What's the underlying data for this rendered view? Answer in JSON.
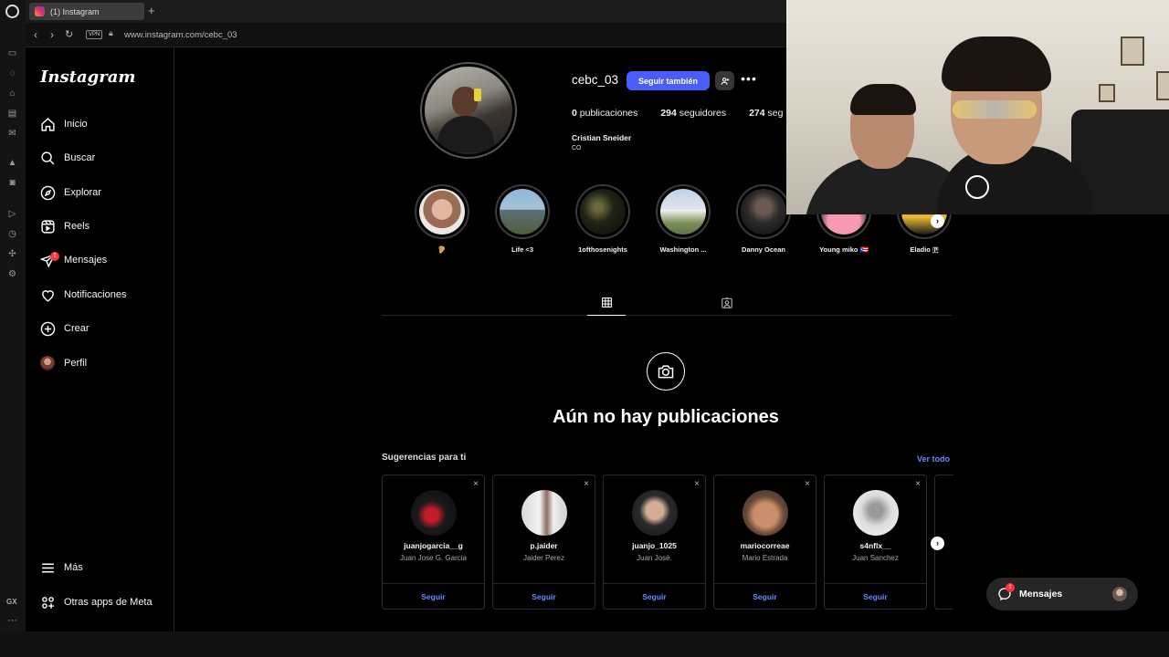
{
  "browser": {
    "tab_title": "(1) Instagram",
    "new_tab": "+",
    "url": "www.instagram.com/cebc_03",
    "vpn_label": "VPN",
    "gx_label": "GX",
    "more_dots": "···"
  },
  "sidebar": {
    "logo": "Instagram",
    "items": [
      {
        "label": "Inicio",
        "icon": "home-icon"
      },
      {
        "label": "Buscar",
        "icon": "search-icon"
      },
      {
        "label": "Explorar",
        "icon": "compass-icon"
      },
      {
        "label": "Reels",
        "icon": "reels-icon"
      },
      {
        "label": "Mensajes",
        "icon": "messenger-icon",
        "badge": "1"
      },
      {
        "label": "Notificaciones",
        "icon": "heart-icon"
      },
      {
        "label": "Crear",
        "icon": "plus-square-icon"
      },
      {
        "label": "Perfil",
        "icon": "avatar"
      }
    ],
    "bottom": [
      {
        "label": "Más",
        "icon": "menu-icon"
      },
      {
        "label": "Otras apps de Meta",
        "icon": "meta-apps-icon"
      }
    ]
  },
  "profile": {
    "username": "cebc_03",
    "follow_label": "Seguir también",
    "posts_count": "0",
    "posts_label": "publicaciones",
    "followers_count": "294",
    "followers_label": "seguidores",
    "following_count": "274",
    "following_label": "seg",
    "full_name": "Cristian Sneider",
    "bio": "CO"
  },
  "highlights": [
    {
      "caption": "🦻"
    },
    {
      "caption": "Life <3"
    },
    {
      "caption": "1ofthosenights"
    },
    {
      "caption": "Washington ..."
    },
    {
      "caption": "Danny Ocean"
    },
    {
      "caption": "Young miko 🇵🇷"
    },
    {
      "caption": "Eladio 🇵"
    }
  ],
  "empty_state": {
    "title": "Aún no hay publicaciones"
  },
  "suggestions": {
    "heading": "Sugerencias para ti",
    "see_all": "Ver todo",
    "follow_label": "Seguir",
    "close": "×",
    "cards": [
      {
        "username": "juanjogarcia__g",
        "name": "Juan Jose G. Garcia"
      },
      {
        "username": "p.jaider",
        "name": "Jaider Perez"
      },
      {
        "username": "juanjo_1025",
        "name": "Juan José."
      },
      {
        "username": "mariocorreae",
        "name": "Mario Estrada"
      },
      {
        "username": "s4nflx__",
        "name": "Juan Sanchez"
      }
    ]
  },
  "messages_float": {
    "label": "Mensajes",
    "badge": "1"
  },
  "colors": {
    "accent": "#4a5df9",
    "link": "#6a89ff",
    "badge": "#ff3040"
  }
}
